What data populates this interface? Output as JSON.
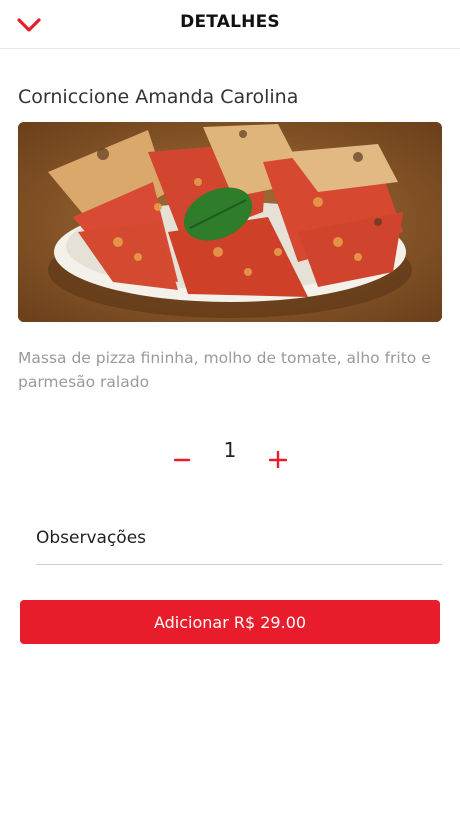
{
  "header": {
    "title": "DETALHES",
    "back_icon": "chevron-down-icon"
  },
  "product": {
    "name": "Corniccione Amanda Carolina",
    "description": "Massa de pizza fininha, molho de tomate, alho frito e parmesão ralado",
    "image_icon": "pizza-photo"
  },
  "quantity": {
    "value": "1",
    "minus_icon": "minus-icon",
    "plus_icon": "plus-icon"
  },
  "observations": {
    "placeholder": "Observações",
    "value": ""
  },
  "add_button": {
    "label": "Adicionar R$ 29.00"
  },
  "colors": {
    "accent": "#e81c2a",
    "text": "#222222",
    "muted": "#9a9a9a",
    "divider": "#e6e6e6"
  }
}
